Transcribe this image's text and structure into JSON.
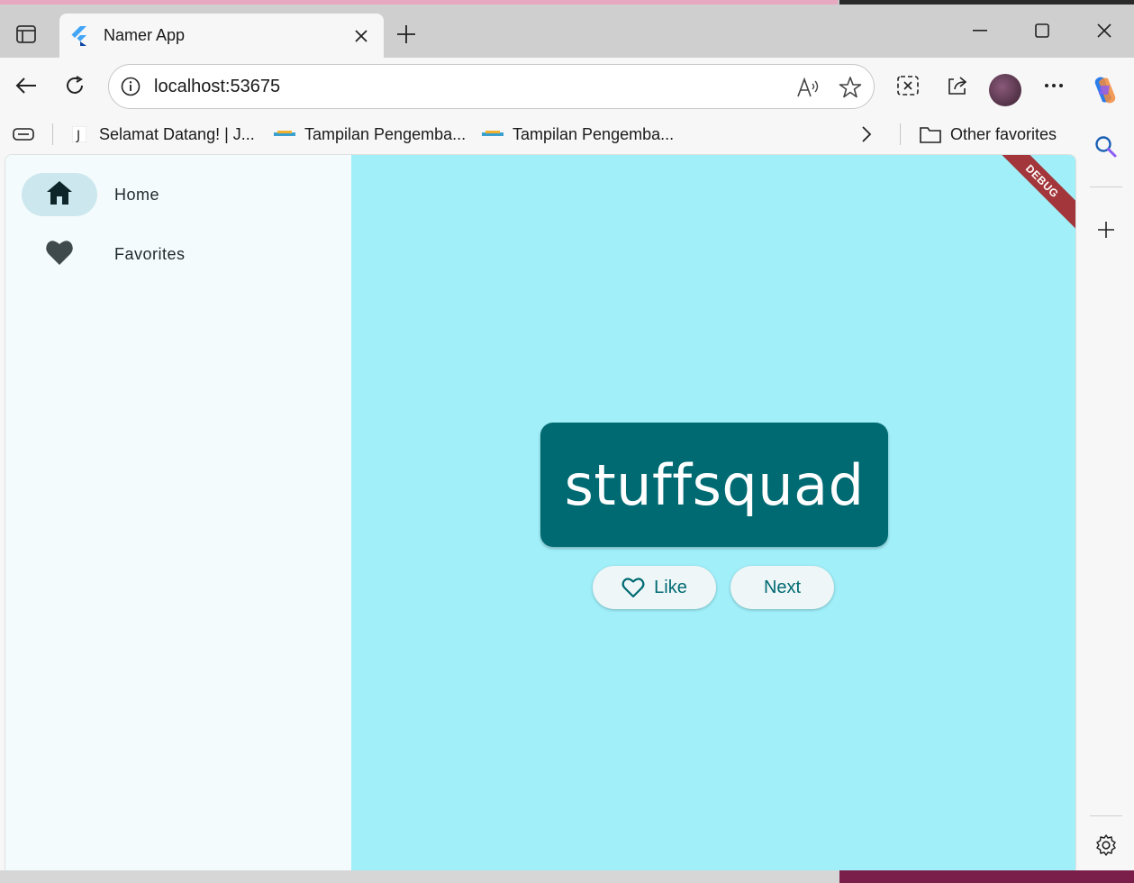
{
  "browser": {
    "tab_title": "Namer App",
    "url": "localhost:53675",
    "favorites": [
      {
        "label": "Selamat Datang! | J..."
      },
      {
        "label": "Tampilan Pengemba..."
      },
      {
        "label": "Tampilan Pengemba..."
      }
    ],
    "other_favorites": "Other favorites"
  },
  "app": {
    "nav": [
      {
        "label": "Home",
        "icon": "home-icon",
        "selected": true
      },
      {
        "label": "Favorites",
        "icon": "heart-icon",
        "selected": false
      }
    ],
    "word": "stuffsquad",
    "like_label": "Like",
    "next_label": "Next",
    "debug_banner": "DEBUG"
  },
  "colors": {
    "primary": "#006a72",
    "main_background": "#a0eff9",
    "rail_background": "#f4fbfc",
    "rail_indicator": "#cce8ee",
    "debug_banner": "#a3363a"
  }
}
